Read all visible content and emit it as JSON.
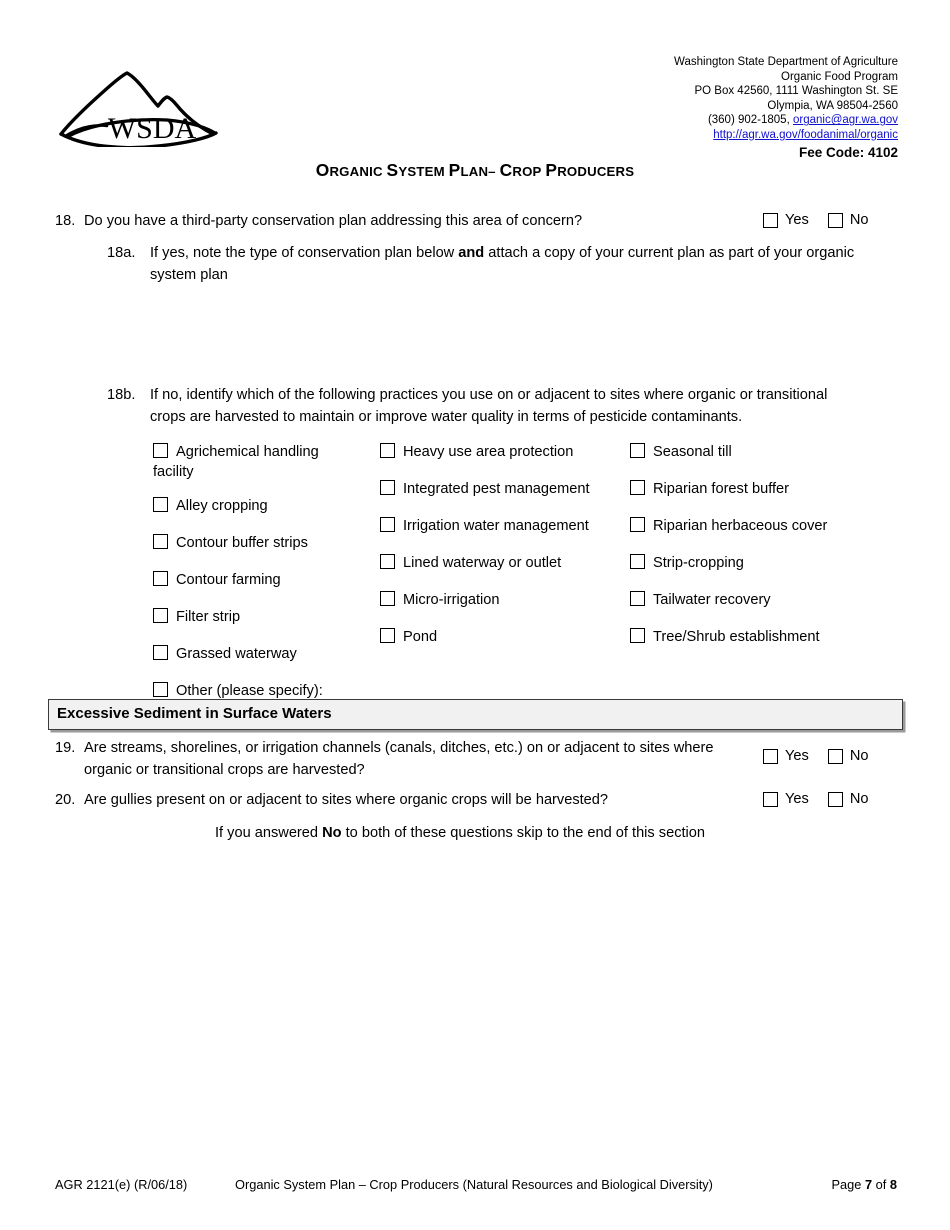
{
  "agency": {
    "line1": "Washington State Department of Agriculture",
    "line2": "Organic Food Program",
    "line3": "PO Box 42560, 1111 Washington St. SE",
    "line4": "Olympia, WA 98504-2560",
    "phone_prefix": "(360) 902-1805, ",
    "email": "organic@agr.wa.gov",
    "url": "http://agr.wa.gov/foodanimal/organic",
    "fee_code": "Fee Code: 4102",
    "link_color": "#1010cf"
  },
  "logo": {
    "wordmark": "WSDA",
    "alt": "wsda-mountain-logo"
  },
  "title": {
    "parts": [
      {
        "cap": "O",
        "rest": "RGANIC"
      },
      {
        "cap": "S",
        "rest": "YSTEM"
      },
      {
        "cap": "P",
        "rest": "LAN–"
      },
      {
        "cap": "C",
        "rest": "ROP"
      },
      {
        "cap": "P",
        "rest": "RODUCERS"
      }
    ],
    "plain": "ORGANIC SYSTEM PLAN– CROP PRODUCERS"
  },
  "q18": {
    "number": "18.",
    "text": "Do you have a third-party conservation plan addressing this area of concern?",
    "yes": "Yes",
    "no": "No"
  },
  "q18a": {
    "number": "18a.",
    "text_before_bold": "If yes, note the type of conservation plan below ",
    "bold": "and",
    "text_after_bold": " attach a copy of your current plan as part of your organic system plan"
  },
  "q18b": {
    "number": "18b.",
    "text": "If no, identify which of the following practices you use on or adjacent to sites where organic or transitional crops are harvested to maintain or improve water quality in terms of pesticide contaminants."
  },
  "practices": {
    "column1": [
      "Agrichemical handling facility",
      "Alley cropping",
      "Contour buffer strips",
      "Contour farming",
      "Filter strip",
      "Grassed waterway",
      "Other (please specify):"
    ],
    "column2": [
      "Heavy use area protection",
      "Integrated pest management",
      "Irrigation water management",
      "Lined waterway or outlet",
      "Micro-irrigation",
      "Pond"
    ],
    "column3": [
      "Seasonal till",
      "Riparian forest buffer",
      "Riparian herbaceous cover",
      "Strip-cropping",
      "Tailwater recovery",
      "Tree/Shrub establishment"
    ]
  },
  "section": {
    "title": "Excessive Sediment in Surface Waters",
    "background": "#f1f1f1"
  },
  "q19": {
    "number": "19.",
    "line1": "Are streams, shorelines, or irrigation channels (canals, ditches, etc.) on or adjacent to sites where",
    "line2": "organic or transitional crops are harvested?",
    "yes": "Yes",
    "no": "No"
  },
  "q20": {
    "number": "20.",
    "text": "Are gullies present on or adjacent to sites where organic crops will be harvested?",
    "yes": "Yes",
    "no": "No"
  },
  "skip_note": {
    "before": "If you answered ",
    "bold": "No",
    "after": " to both of these questions skip to the end of this section"
  },
  "footer": {
    "form_id": "AGR 2121(e) (R/06/18)",
    "center": "Organic System Plan – Crop Producers (Natural Resources and Biological Diversity)",
    "page_label": "Page ",
    "page_number": "7",
    "page_of": " of ",
    "page_total": "8"
  }
}
